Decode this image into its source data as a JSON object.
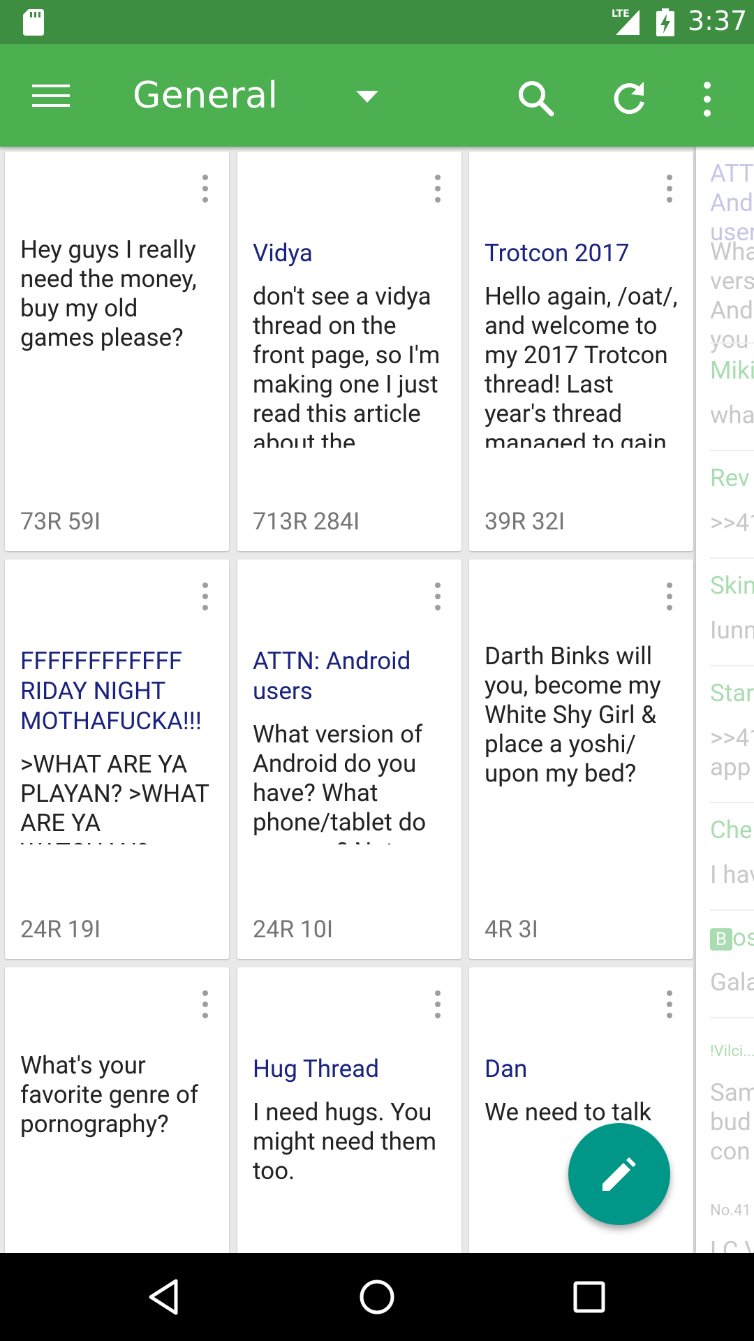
{
  "status_bar": {
    "time": "3:37",
    "network": "LTE",
    "icons": [
      "sd-card-icon",
      "signal-icon",
      "battery-charging-icon"
    ]
  },
  "toolbar": {
    "title": "General",
    "icons": [
      "menu-icon",
      "dropdown-arrow-icon",
      "search-icon",
      "refresh-icon",
      "more-vert-icon"
    ]
  },
  "threads": [
    {
      "title": "",
      "body": "Hey guys I really need the money, buy my old games please?",
      "stats": "73R 59I"
    },
    {
      "title": "Vidya",
      "body": "don't see a vidya thread on the front page, so I'm making one I just read this article about the ...",
      "stats": "713R 284I"
    },
    {
      "title": "Trotcon 2017",
      "body": "Hello again, /oat/, and welcome to my 2017 Trotcon thread! Last year's thread managed to gain",
      "stats": "39R 32I"
    },
    {
      "title": "FFFFFFFFFFFF RIDAY NIGHT MOTHAFUCKA!!!",
      "body": ">WHAT ARE YA PLAYAN? >WHAT ARE YA WATCHAN? >WHAT ARE YA LISTENAN?",
      "stats": "24R 19I"
    },
    {
      "title": "ATTN: Android users",
      "body": "What version of Android do you have? What phone/tablet do you use? Not a government plant, just curious.",
      "stats": "24R 10I"
    },
    {
      "title": "",
      "body": "Darth Binks will you, become my White Shy Girl & place a yoshi/ upon my bed?",
      "stats": "4R 3I"
    },
    {
      "title": "",
      "body": "What's your favorite genre of pornography?",
      "stats": ""
    },
    {
      "title": "Hug Thread",
      "body": "I need hugs. You might need them too.",
      "stats": ""
    },
    {
      "title": "Dan",
      "body": "We need to talk",
      "stats": ""
    }
  ],
  "drawer": {
    "items": [
      {
        "title": "ATTN: Android users Star",
        "body": "What version of Android do you Pon"
      },
      {
        "title": "Miki",
        "body": "wha"
      },
      {
        "title": "Rev",
        "body": ">>41"
      },
      {
        "title": "Skin",
        "body": "Iunn"
      },
      {
        "title": "Star",
        "body": ">>41 app"
      },
      {
        "title": "Che",
        "body": "I hav"
      },
      {
        "badge": "B",
        "title": "os",
        "body": "Gala"
      },
      {
        "small": "!Vilci...",
        "body": "Sam bud con"
      },
      {
        "small": "No.41",
        "body": "LC V"
      }
    ]
  },
  "fab": {
    "icon": "edit-pencil-icon"
  },
  "nav_bar": {
    "icons": [
      "back-icon",
      "home-icon",
      "recents-icon"
    ]
  },
  "colors": {
    "status_bar": "#3e8e41",
    "toolbar": "#4caf50",
    "fab": "#009688",
    "thread_title": "#1a237e",
    "stats_text": "#757575"
  }
}
